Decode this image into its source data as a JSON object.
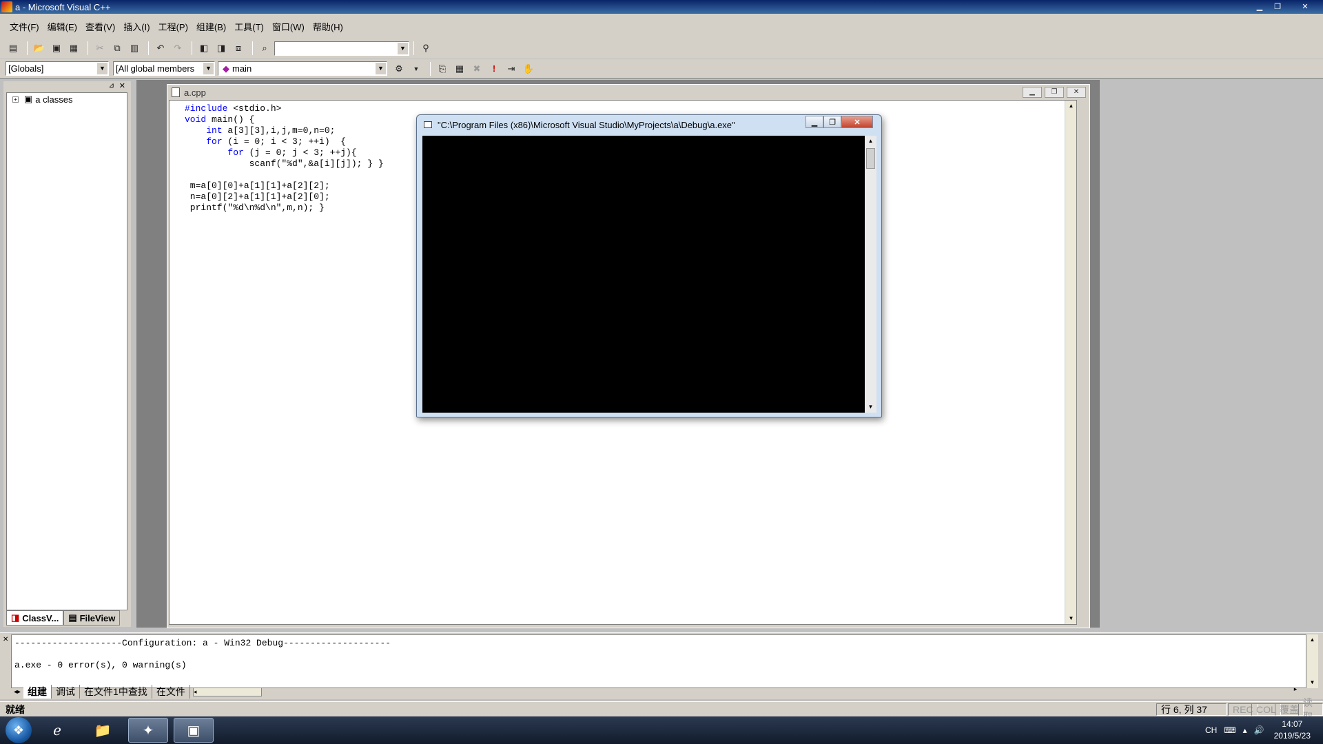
{
  "window": {
    "title": "a - Microsoft Visual C++",
    "minimize": "▁",
    "restore": "❐",
    "close": "✕"
  },
  "menu": [
    "文件(F)",
    "编辑(E)",
    "查看(V)",
    "插入(I)",
    "工程(P)",
    "组建(B)",
    "工具(T)",
    "窗口(W)",
    "帮助(H)"
  ],
  "toolbar": {
    "find_combo_value": "",
    "globals_combo": "[Globals]",
    "members_combo": "[All global members",
    "function_combo": "main"
  },
  "workspace": {
    "tree_root": "a classes",
    "tabs": [
      "ClassV...",
      "FileView"
    ]
  },
  "editor": {
    "filename": "a.cpp",
    "code_lines": [
      [
        [
          "kw",
          "#include"
        ],
        [
          "",
          " <stdio.h>"
        ]
      ],
      [
        [
          "kw",
          "void"
        ],
        [
          "",
          " main() {"
        ]
      ],
      [
        [
          "",
          "    "
        ],
        [
          "kw",
          "int"
        ],
        [
          "",
          " a[3][3],i,j,m=0,n=0;"
        ]
      ],
      [
        [
          "",
          "    "
        ],
        [
          "kw",
          "for"
        ],
        [
          "",
          " (i = 0; i < 3; ++i)  {"
        ]
      ],
      [
        [
          "",
          "        "
        ],
        [
          "kw",
          "for"
        ],
        [
          "",
          " (j = 0; j < 3; ++j){"
        ]
      ],
      [
        [
          "",
          "            scanf(\"%d\",&a[i][j]); } }"
        ]
      ],
      [
        [
          "",
          ""
        ]
      ],
      [
        [
          "",
          " m=a[0][0]+a[1][1]+a[2][2];"
        ]
      ],
      [
        [
          "",
          " n=a[0][2]+a[1][1]+a[2][0];"
        ]
      ],
      [
        [
          "",
          " printf(\"%d\\n%d\\n\",m,n); }"
        ]
      ]
    ]
  },
  "console": {
    "title": "\"C:\\Program Files (x86)\\Microsoft Visual Studio\\MyProjects\\a\\Debug\\a.exe\""
  },
  "output": {
    "lines": [
      "--------------------Configuration: a - Win32 Debug--------------------",
      "",
      "a.exe - 0 error(s), 0 warning(s)"
    ],
    "tabs": [
      "组建",
      "调试",
      "在文件1中查找",
      "在文件"
    ]
  },
  "status": {
    "text": "就绪",
    "position": "行 6, 列 37",
    "indicators": [
      "REC",
      "COL",
      "覆盖",
      "读取"
    ]
  },
  "taskbar": {
    "tray_lang": "CH",
    "time": "14:07",
    "date": "2019/5/23"
  }
}
